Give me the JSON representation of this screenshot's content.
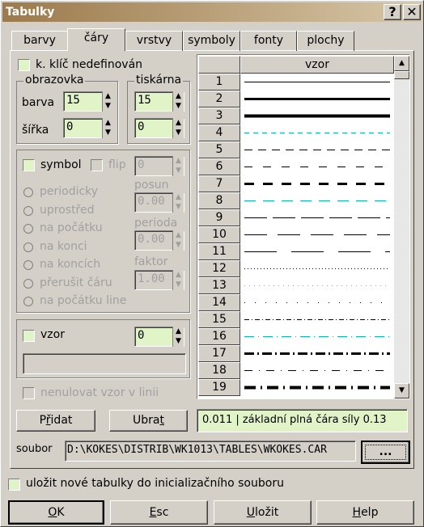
{
  "window": {
    "title": "Tabulky",
    "help_button": "?",
    "close_button": "✕"
  },
  "tabs": [
    {
      "label": "barvy"
    },
    {
      "label": "čáry",
      "active": true
    },
    {
      "label": "vrstvy"
    },
    {
      "label": "symboly"
    },
    {
      "label": "fonty"
    },
    {
      "label": "plochy"
    }
  ],
  "key_checkbox": {
    "label": "k. klíč nedefinován",
    "checked": false
  },
  "screen": {
    "title": "obrazovka",
    "color_label": "barva",
    "color": "15",
    "width_label": "šířka",
    "width": "0"
  },
  "printer": {
    "title": "tiskárna",
    "color": "15",
    "width": "0"
  },
  "symbol": {
    "label": "symbol",
    "flip_label": "flip",
    "flip_value": "0",
    "options": [
      "periodicky",
      "uprostřed",
      "na počátku",
      "na konci",
      "na koncích",
      "přerušit čáru",
      "na počátku line"
    ],
    "shift_label": "posun",
    "shift": "0.00",
    "period_label": "perioda",
    "period": "0.00",
    "factor_label": "faktor",
    "factor": "1.00"
  },
  "pattern": {
    "label": "vzor",
    "value": "0",
    "text": ""
  },
  "no_reset": {
    "label": "nenulovat vzor v linii"
  },
  "table": {
    "header": "vzor",
    "rows": [
      {
        "n": "1",
        "color": "#000000"
      },
      {
        "n": "2",
        "color": "#000000"
      },
      {
        "n": "3",
        "color": "#000000"
      },
      {
        "n": "4",
        "color": "#00b8b8"
      },
      {
        "n": "5",
        "color": "#000000"
      },
      {
        "n": "6",
        "color": "#000000"
      },
      {
        "n": "7",
        "color": "#000000"
      },
      {
        "n": "8",
        "color": "#00b8b8"
      },
      {
        "n": "9",
        "color": "#000000"
      },
      {
        "n": "10",
        "color": "#000000"
      },
      {
        "n": "11",
        "color": "#000000"
      },
      {
        "n": "12",
        "color": "#000000"
      },
      {
        "n": "13",
        "color": "#d0a040"
      },
      {
        "n": "14",
        "color": "#000000"
      },
      {
        "n": "15",
        "color": "#000000"
      },
      {
        "n": "16",
        "color": "#00b8b8"
      },
      {
        "n": "17",
        "color": "#000000"
      },
      {
        "n": "18",
        "color": "#000000"
      },
      {
        "n": "19",
        "color": "#000000"
      }
    ]
  },
  "buttons": {
    "add_pre": "P",
    "add_u": "ř",
    "add_post": "idat",
    "remove_pre": "Ubra",
    "remove_u": "t",
    "remove_post": "",
    "browse": "..."
  },
  "status": "0.011 | základní plná čára síly 0.13",
  "file": {
    "label": "soubor",
    "path": "D:\\KOKES\\DISTRIB\\WK1013\\TABLES\\WKOKES.CAR"
  },
  "save_init": {
    "label": "uložit nové tabulky do inicializačního souboru"
  },
  "footer": {
    "ok_u": "O",
    "ok": "K",
    "esc_u": "E",
    "esc": "sc",
    "save_u": "U",
    "save": "ložit",
    "help_u": "H",
    "help": "elp"
  }
}
